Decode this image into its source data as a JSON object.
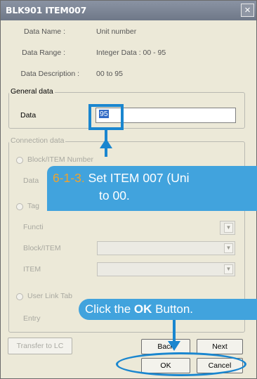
{
  "window": {
    "title": "BLK901 ITEM007",
    "close_glyph": "×"
  },
  "info": [
    {
      "label": "Data Name :",
      "value": "Unit number"
    },
    {
      "label": "Data Range :",
      "value": "Integer Data : 00 - 95"
    },
    {
      "label": "Data Description :",
      "value": "00 to 95"
    }
  ],
  "general": {
    "legend": "General data",
    "data_label": "Data",
    "data_value": "95"
  },
  "connection": {
    "legend": "Connection data",
    "radio_block": "Block/ITEM Number",
    "data_label": "Data",
    "radio_tag": "Tag",
    "function_label": "Functi",
    "block_item_label": "Block/ITEM",
    "item_label": "ITEM",
    "radio_user_link": "User Link Tab",
    "entry_label": "Entry"
  },
  "buttons": {
    "transfer": "Transfer to LC",
    "back": "Back",
    "next": "Next",
    "ok": "OK",
    "cancel": "Cancel"
  },
  "callouts": {
    "step_number": "6-1-3.",
    "step_text_line1": " Set ITEM 007 (Uni",
    "step_text_line2": "to 00.",
    "click_prefix": "Click the ",
    "click_bold": "OK",
    "click_suffix": " Button."
  },
  "colors": {
    "callout_bg": "#41a3dd",
    "highlight_line": "#1a86cf",
    "step_number": "#f0a32c"
  }
}
